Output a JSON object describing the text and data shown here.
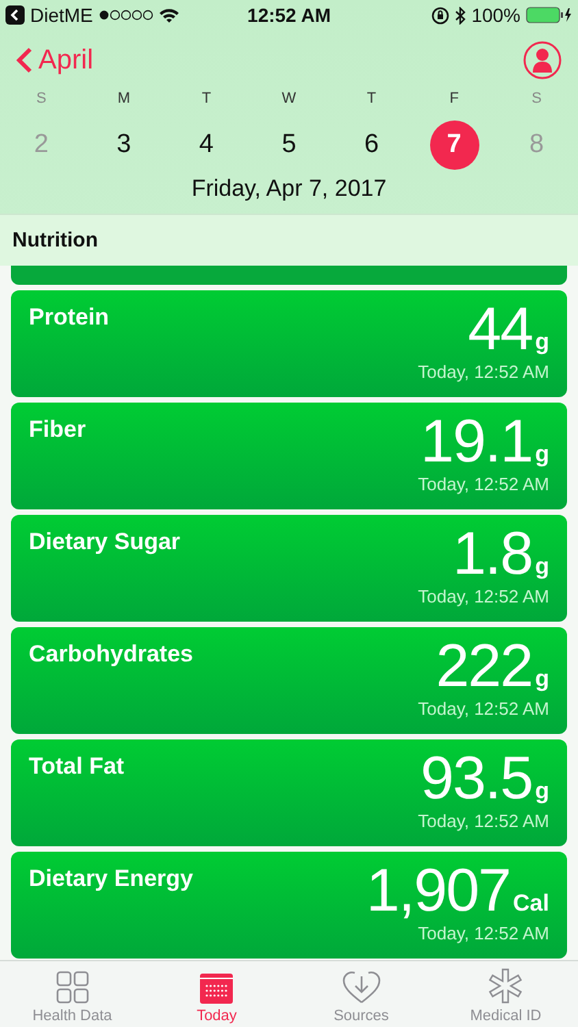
{
  "status_bar": {
    "back_app": "DietME",
    "time": "12:52 AM",
    "battery": "100%"
  },
  "nav": {
    "back_label": "April"
  },
  "week": [
    {
      "weekday": "S",
      "day": "2",
      "dimmed": true,
      "selected": false
    },
    {
      "weekday": "M",
      "day": "3",
      "dimmed": false,
      "selected": false
    },
    {
      "weekday": "T",
      "day": "4",
      "dimmed": false,
      "selected": false
    },
    {
      "weekday": "W",
      "day": "5",
      "dimmed": false,
      "selected": false
    },
    {
      "weekday": "T",
      "day": "6",
      "dimmed": false,
      "selected": false
    },
    {
      "weekday": "F",
      "day": "7",
      "dimmed": false,
      "selected": true
    },
    {
      "weekday": "S",
      "day": "8",
      "dimmed": true,
      "selected": false
    }
  ],
  "date_label": "Friday, Apr 7, 2017",
  "section_title": "Nutrition",
  "cards": [
    {
      "name": "Protein",
      "value": "44",
      "unit": "g",
      "timestamp": "Today, 12:52 AM"
    },
    {
      "name": "Fiber",
      "value": "19.1",
      "unit": "g",
      "timestamp": "Today, 12:52 AM"
    },
    {
      "name": "Dietary Sugar",
      "value": "1.8",
      "unit": "g",
      "timestamp": "Today, 12:52 AM"
    },
    {
      "name": "Carbohydrates",
      "value": "222",
      "unit": "g",
      "timestamp": "Today, 12:52 AM"
    },
    {
      "name": "Total Fat",
      "value": "93.5",
      "unit": "g",
      "timestamp": "Today, 12:52 AM"
    },
    {
      "name": "Dietary Energy",
      "value": "1,907",
      "unit": "Cal",
      "timestamp": "Today, 12:52 AM"
    }
  ],
  "tabs": [
    {
      "kind": "grid",
      "label": "Health Data",
      "selected": false
    },
    {
      "kind": "calendar",
      "label": "Today",
      "selected": true
    },
    {
      "kind": "heart",
      "label": "Sources",
      "selected": false
    },
    {
      "kind": "asterisk",
      "label": "Medical ID",
      "selected": false
    }
  ]
}
